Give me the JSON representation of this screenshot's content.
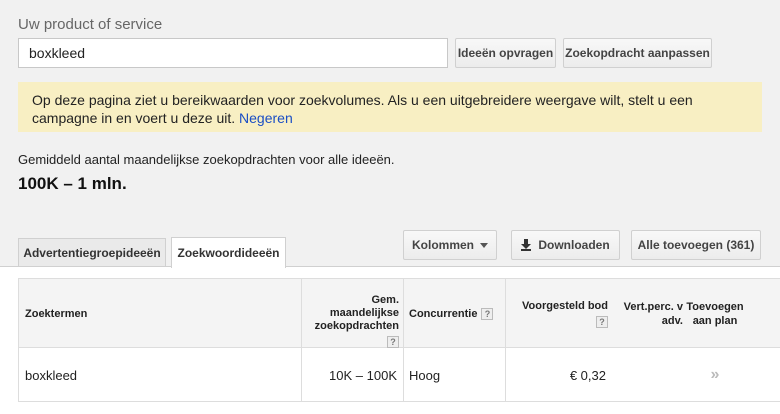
{
  "search": {
    "label": "Uw product of service",
    "value": "boxkleed"
  },
  "buttons": {
    "get_ideas": "Ideeën opvragen",
    "adjust_search": "Zoekopdracht aanpassen",
    "columns": "Kolommen",
    "download": "Downloaden",
    "add_all": "Alle toevoegen (361)"
  },
  "notice": {
    "text": "Op deze pagina ziet u bereikwaarden voor zoekvolumes. Als u een uitgebreidere weergave wilt, stelt u een campagne in en voert u deze uit.",
    "link": "Negeren"
  },
  "summary": {
    "label": "Gemiddeld aantal maandelijkse zoekopdrachten voor alle ideeën.",
    "value": "100K – 1 mln."
  },
  "tabs": [
    {
      "label": "Advertentiegroepideeën",
      "active": false
    },
    {
      "label": "Zoekwoordideeën",
      "active": true
    }
  ],
  "table": {
    "headers": {
      "term": "Zoektermen",
      "volume_l1": "Gem.",
      "volume_l2": "maandelijkse",
      "volume_l3": "zoekopdrachten",
      "competition": "Concurrentie",
      "bid": "Voorgesteld bod",
      "share_l1": "Vert.perc. v",
      "share_l2": "adv.",
      "add_l1": "Toevoegen",
      "add_l2": "aan plan",
      "help": "?"
    },
    "rows": [
      {
        "term": "boxkleed",
        "volume": "10K – 100K",
        "competition": "Hoog",
        "bid": "€ 0,32",
        "add": "»"
      }
    ]
  }
}
